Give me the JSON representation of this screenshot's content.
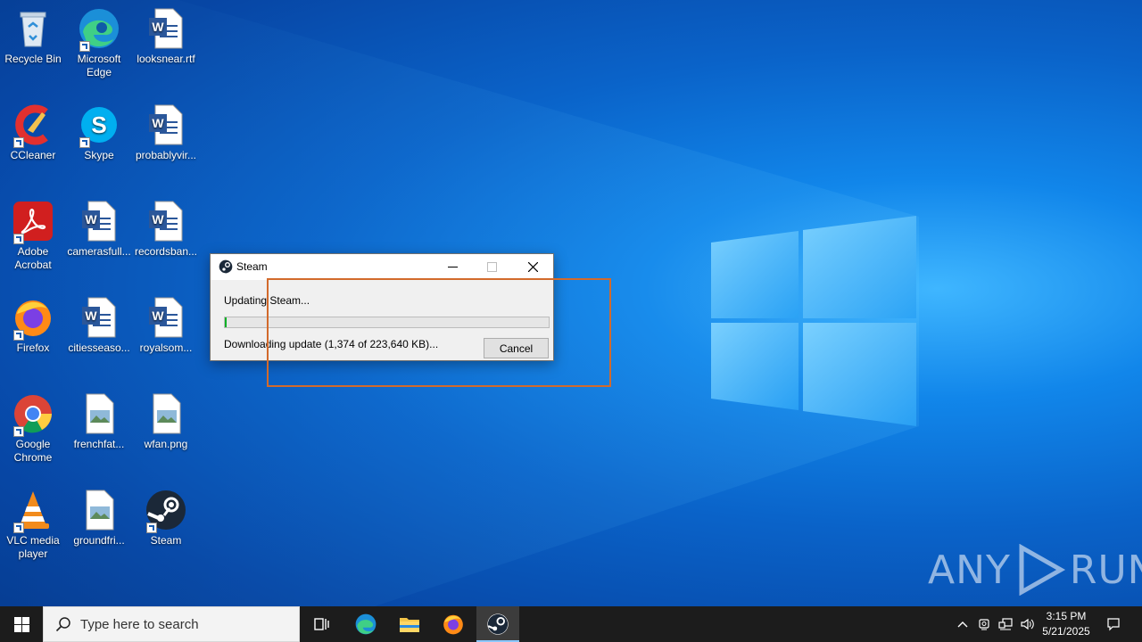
{
  "desktop": {
    "icons": [
      {
        "label": "Recycle Bin",
        "icon": "recycle-bin-icon"
      },
      {
        "label": "Microsoft Edge",
        "icon": "edge-icon"
      },
      {
        "label": "looksnear.rtf",
        "icon": "word-document-icon"
      },
      {
        "label": "CCleaner",
        "icon": "ccleaner-icon"
      },
      {
        "label": "Skype",
        "icon": "skype-icon"
      },
      {
        "label": "probablyvir...",
        "icon": "word-document-icon"
      },
      {
        "label": "Adobe Acrobat",
        "icon": "acrobat-icon"
      },
      {
        "label": "camerasfull...",
        "icon": "word-document-icon"
      },
      {
        "label": "recordsban...",
        "icon": "word-document-icon"
      },
      {
        "label": "Firefox",
        "icon": "firefox-icon"
      },
      {
        "label": "citiesseaso...",
        "icon": "word-document-icon"
      },
      {
        "label": "royalsom...",
        "icon": "word-document-icon"
      },
      {
        "label": "Google Chrome",
        "icon": "chrome-icon"
      },
      {
        "label": "frenchfat...",
        "icon": "image-file-icon"
      },
      {
        "label": "wfan.png",
        "icon": "image-file-icon"
      },
      {
        "label": "VLC media player",
        "icon": "vlc-icon"
      },
      {
        "label": "groundfri...",
        "icon": "image-file-icon"
      },
      {
        "label": "Steam",
        "icon": "steam-icon"
      }
    ]
  },
  "dialog": {
    "title": "Steam",
    "status": "Updating Steam...",
    "progress": 0.006,
    "detail": "Downloading update (1,374 of 223,640 KB)...",
    "cancel_label": "Cancel",
    "minimize_icon": "minimize-icon",
    "maximize_icon": "maximize-icon",
    "close_icon": "close-icon"
  },
  "watermark": {
    "text_left": "ANY",
    "text_right": "RUN"
  },
  "taskbar": {
    "search_placeholder": "Type here to search",
    "apps": [
      "task-view-icon",
      "edge-icon",
      "file-explorer-icon",
      "firefox-icon",
      "steam-icon"
    ],
    "active_app": "steam-icon",
    "time": "3:15 PM",
    "date": "5/21/2025"
  },
  "colors": {
    "desktop_blue": "#0a63c9",
    "taskbar": "#1c1c1c",
    "selection_orange": "#d26a2c",
    "progress_green": "#06b025"
  }
}
